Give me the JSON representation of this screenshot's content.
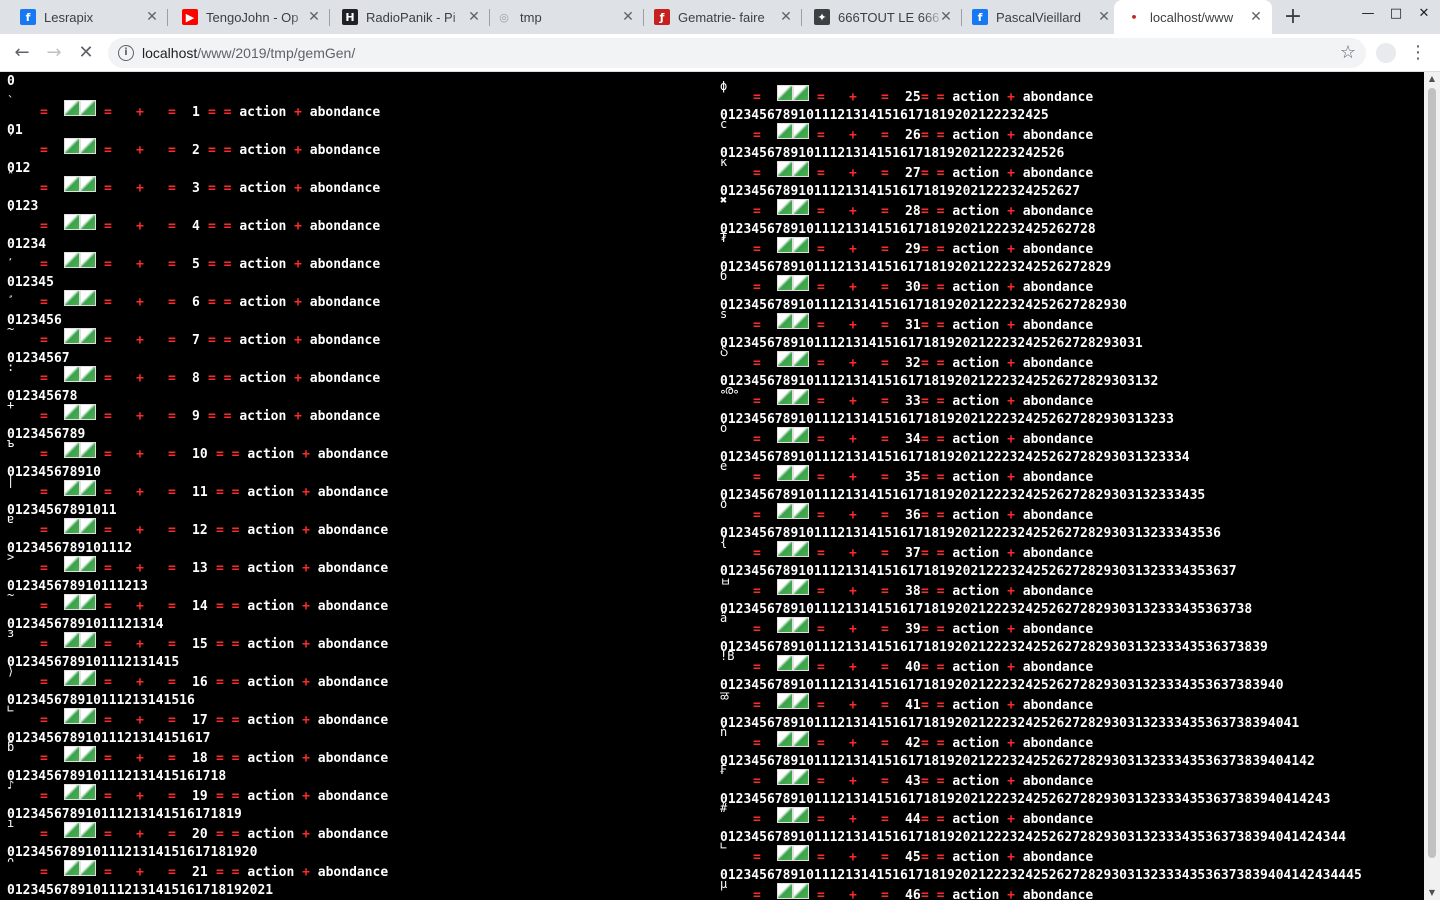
{
  "browser": {
    "tabs": [
      {
        "title": "Les rapix",
        "icon": "facebook-icon",
        "icon_glyph": "f",
        "icon_color": "#1877f2"
      },
      {
        "title": "Tengo John - Op",
        "icon": "youtube-icon",
        "icon_glyph": "▶",
        "icon_color": "#ff0000"
      },
      {
        "title": "Radio Panik - Pi",
        "icon": "radio-panik-icon",
        "icon_glyph": "H",
        "icon_color": "#202124"
      },
      {
        "title": "tmp",
        "icon": "globe-icon",
        "icon_glyph": "◎",
        "icon_color": "#9aa0a6"
      },
      {
        "title": "Gematrie - faire",
        "icon": "gematrie-icon",
        "icon_glyph": "ƒ",
        "icon_color": "#c5221f"
      },
      {
        "title": "666 TOUT LE 666",
        "icon": "666-site-icon",
        "icon_glyph": "✦",
        "icon_color": "#3c4043"
      },
      {
        "title": "Pascal Vieillard",
        "icon": "facebook-icon",
        "icon_glyph": "f",
        "icon_color": "#1877f2"
      },
      {
        "title": "localhost/www",
        "icon": "loading-icon",
        "icon_glyph": "•",
        "icon_color": "#ffffff"
      }
    ],
    "url_host": "localhost",
    "url_path": "/www/2019/tmp/gemGen/"
  },
  "content": {
    "eq": "=",
    "plus": "+",
    "word_action": "action",
    "word_abondance": "abondance",
    "left_first": {
      "digits": "0"
    },
    "left": [
      {
        "sym": "̀",
        "n": "1",
        "digits": "01"
      },
      {
        "sym": "́",
        "n": "2",
        "digits": "012"
      },
      {
        "sym": "̂",
        "n": "3",
        "digits": "0123"
      },
      {
        "sym": "̇",
        "n": "4",
        "digits": "01234"
      },
      {
        "sym": "̦",
        "n": "5",
        "digits": "012345"
      },
      {
        "sym": "̧",
        "n": "6",
        "digits": "0123456"
      },
      {
        "sym": "~",
        "n": "7",
        "digits": "01234567"
      },
      {
        "sym": ":",
        "n": "8",
        "digits": "012345678"
      },
      {
        "sym": "+",
        "n": "9",
        "digits": "0123456789"
      },
      {
        "sym": "ъ",
        "n": "10",
        "digits": "012345678910"
      },
      {
        "sym": "|",
        "n": "11",
        "digits": "01234567891011"
      },
      {
        "sym": "ɐ",
        "n": "12",
        "digits": "0123456789101112"
      },
      {
        "sym": ">",
        "n": "13",
        "digits": "012345678910111213"
      },
      {
        "sym": "~",
        "n": "14",
        "digits": "01234567891011121314"
      },
      {
        "sym": "ɜ",
        "n": "15",
        "digits": "0123456789101112131415"
      },
      {
        "sym": "⟩",
        "n": "16",
        "digits": "012345678910111213141516"
      },
      {
        "sym": "∟",
        "n": "17",
        "digits": "01234567891011121314151617"
      },
      {
        "sym": "ƃ",
        "n": "18",
        "digits": "0123456789101112131415161718"
      },
      {
        "sym": "♪",
        "n": "19",
        "digits": "012345678910111213141516171819"
      },
      {
        "sym": "ı",
        "n": "20",
        "digits": "01234567891011121314151617181920"
      },
      {
        "sym": "ᴖ",
        "n": "21",
        "digits": "0123456789101112131415161718192021"
      }
    ],
    "right": [
      {
        "sym": "ϕ",
        "n": "25",
        "digits": "0123456789101112131415161718192021222324 25"
      },
      {
        "sym": "č",
        "n": "26",
        "digits": "012345678910111213141516171819202122232425 26"
      },
      {
        "sym": "ĸ",
        "n": "27",
        "digits": "01234567891011121314151617181920212223242526 27"
      },
      {
        "sym": "✖",
        "n": "28",
        "digits": "0123456789101112131415161718192021222324252627 28"
      },
      {
        "sym": "₮",
        "n": "29",
        "digits": "012345678910111213141516171819202122232425262728 29"
      },
      {
        "sym": "б",
        "n": "30",
        "digits": "01234567891011121314151617181920212223242526272829 30"
      },
      {
        "sym": "ś",
        "n": "31",
        "digits": "0123456789101112131415161718192021222324252627282930 31"
      },
      {
        "sym": "Ⴢ",
        "n": "32",
        "digits": "012345678910111213141516171819202122232425262728293031 32"
      },
      {
        "sym": "ൟ",
        "n": "33",
        "digits": "01234567891011121314151617181920212223242526272829303132 33"
      },
      {
        "sym": "ȯ",
        "n": "34",
        "digits": "0123456789101112131415161718192021222324252627282930313233 34"
      },
      {
        "sym": "ė",
        "n": "35",
        "digits": "012345678910111213141516171819202122232425262728293031323334 35"
      },
      {
        "sym": "ð",
        "n": "36",
        "digits": "01234567891011121314151617181920212223242526272829303132333435 36"
      },
      {
        "sym": "{",
        "n": "37",
        "digits": "0123456789101112131415161718192021222324252627282930313233343536 37"
      },
      {
        "sym": "ㅂ",
        "n": "38",
        "digits": "012345678910111213141516171819202122232425262728293031323334353637 38"
      },
      {
        "sym": "ä",
        "n": "39",
        "digits": "01234567891011121314151617181920212223242526272829303132333435363738 39"
      },
      {
        "sym": "ǃB",
        "n": "40",
        "digits": "0123456789101112131415161718192021222324252627282930313233343536373839 40"
      },
      {
        "sym": "ळ",
        "n": "41",
        "digits": "012345678910111213141516171819202122232425262728293031323334353637383940 41"
      },
      {
        "sym": "ň",
        "n": "42",
        "digits": "01234567891011121314151617181920212223242526272829303132333435363738394041 42"
      },
      {
        "sym": "₣",
        "n": "43",
        "digits": "0123456789101112131415161718192021222324252627282930313233343536373839404142 43"
      },
      {
        "sym": "#",
        "n": "44",
        "digits": "012345678910111213141516171819202122232425262728293031323334353637383940414243 44"
      },
      {
        "sym": "∟",
        "n": "45",
        "digits": "01234567891011121314151617181920212223242526272829303132333435363738394041424344 45"
      },
      {
        "sym": "µ",
        "n": "46",
        "digits": ""
      }
    ]
  },
  "colors": {
    "accent": "#ff2a2a",
    "page_bg": "#000000",
    "text": "#ffffff"
  }
}
